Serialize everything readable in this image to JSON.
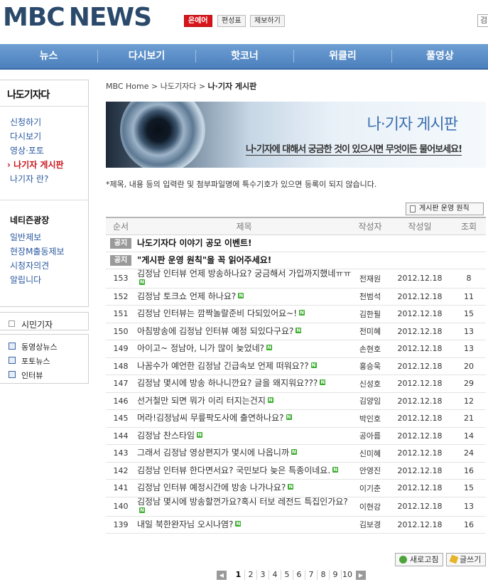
{
  "header": {
    "logo_mbc": "MBC",
    "logo_news": "NEWS",
    "onair": "온에어",
    "schedule": "편성표",
    "report": "제보하기",
    "search_partial": "검"
  },
  "nav": [
    "뉴스",
    "다시보기",
    "핫코너",
    "위클리",
    "풀영상"
  ],
  "sidebar": {
    "title": "나도기자다",
    "links": [
      "신청하기",
      "다시보기",
      "영상·포토",
      "› 나기자 게시판",
      "나기자 란?"
    ],
    "section2_title": "네티즌광장",
    "section2_links": [
      "일반제보",
      "현장M출동제보",
      "시청자의견",
      "알립니다"
    ],
    "citizen": "시민기자",
    "small_links": [
      "동영상뉴스",
      "포토뉴스",
      "인터뷰"
    ]
  },
  "breadcrumb": {
    "home": "MBC Home",
    "sep1": ">",
    "level1": "나도기자다",
    "sep2": ">",
    "current": "나·기자 게시판"
  },
  "banner": {
    "title": "나·기자 게시판",
    "subtitle": "나·기자에 대해서 궁금한 것이 있으시면 무엇이든 물어보세요!"
  },
  "notice_text": "*제목, 내용 등의 입력란 및 첨부파일명에 특수기호가 있으면 등록이 되지 않습니다.",
  "rule_button": "게시판 운영 원칙",
  "table": {
    "headers": [
      "순서",
      "제목",
      "작성자",
      "작성일",
      "조회"
    ],
    "notice_tag": "공지",
    "notices": [
      "나도기자다 이야기 공모 이벤트!",
      "\"게시판 운영 원칙\"을 꼭 읽어주세요!"
    ],
    "new_mark": "N",
    "rows": [
      {
        "num": "153",
        "title": "김정남 인터뷰 언제 방송하나요? 궁금해서 가입까지했네ㅠㅠ",
        "writer": "전재원",
        "date": "2012.12.18",
        "views": "8"
      },
      {
        "num": "152",
        "title": "김정남 토크쇼 언제 하나요?",
        "writer": "천범석",
        "date": "2012.12.18",
        "views": "11"
      },
      {
        "num": "151",
        "title": "김정남 인터뷰는 깜짝놀랄준비 다되있어요~!",
        "writer": "김한필",
        "date": "2012.12.18",
        "views": "15"
      },
      {
        "num": "150",
        "title": "아침방송에 김정남 인터뷰 예정 되있다구요?",
        "writer": "전미혜",
        "date": "2012.12.18",
        "views": "13"
      },
      {
        "num": "149",
        "title": "아이고~ 정남아, 니가 많이 늦었네?",
        "writer": "손현호",
        "date": "2012.12.18",
        "views": "13"
      },
      {
        "num": "148",
        "title": "나꼼수가 예언한 김정남 긴급속보 언제 떠워요??",
        "writer": "홍승욱",
        "date": "2012.12.18",
        "views": "20"
      },
      {
        "num": "147",
        "title": "김정남 몇시에 방송 하나니깐요? 글을 왜지워요???",
        "writer": "신성호",
        "date": "2012.12.18",
        "views": "29"
      },
      {
        "num": "146",
        "title": "선거철만 되면 뭐가 이리 터지는건지",
        "writer": "김양임",
        "date": "2012.12.18",
        "views": "12"
      },
      {
        "num": "145",
        "title": "머라!김정남씨 무릎팍도사에 출연하나요?",
        "writer": "박인호",
        "date": "2012.12.18",
        "views": "21"
      },
      {
        "num": "144",
        "title": "김정남 찬스타임",
        "writer": "공아름",
        "date": "2012.12.18",
        "views": "14"
      },
      {
        "num": "143",
        "title": "그래서 김정남 영상편지가 몇시에 나옵니까",
        "writer": "신미혜",
        "date": "2012.12.18",
        "views": "24"
      },
      {
        "num": "142",
        "title": "김정남 인터뷰 한다면서요? 국민보다 늦은 특종이네요.",
        "writer": "안영진",
        "date": "2012.12.18",
        "views": "16"
      },
      {
        "num": "141",
        "title": "김정남 인터뷰 예정시간에 방송 나가나요?",
        "writer": "이기춘",
        "date": "2012.12.18",
        "views": "15"
      },
      {
        "num": "140",
        "title": "김정남 몇시에 방송할껀가요?혹시 터보 레전드 특집인가요?",
        "writer": "이현강",
        "date": "2012.12.18",
        "views": "13"
      },
      {
        "num": "139",
        "title": "내일 북한완자님 오시나염?",
        "writer": "김보경",
        "date": "2012.12.18",
        "views": "16"
      }
    ]
  },
  "buttons": {
    "refresh": "새로고침",
    "write": "글쓰기"
  },
  "pager": {
    "prev": "◀",
    "next": "▶",
    "pages": [
      "1",
      "2",
      "3",
      "4",
      "5",
      "6",
      "7",
      "8",
      "9",
      "10"
    ],
    "current": "1"
  }
}
